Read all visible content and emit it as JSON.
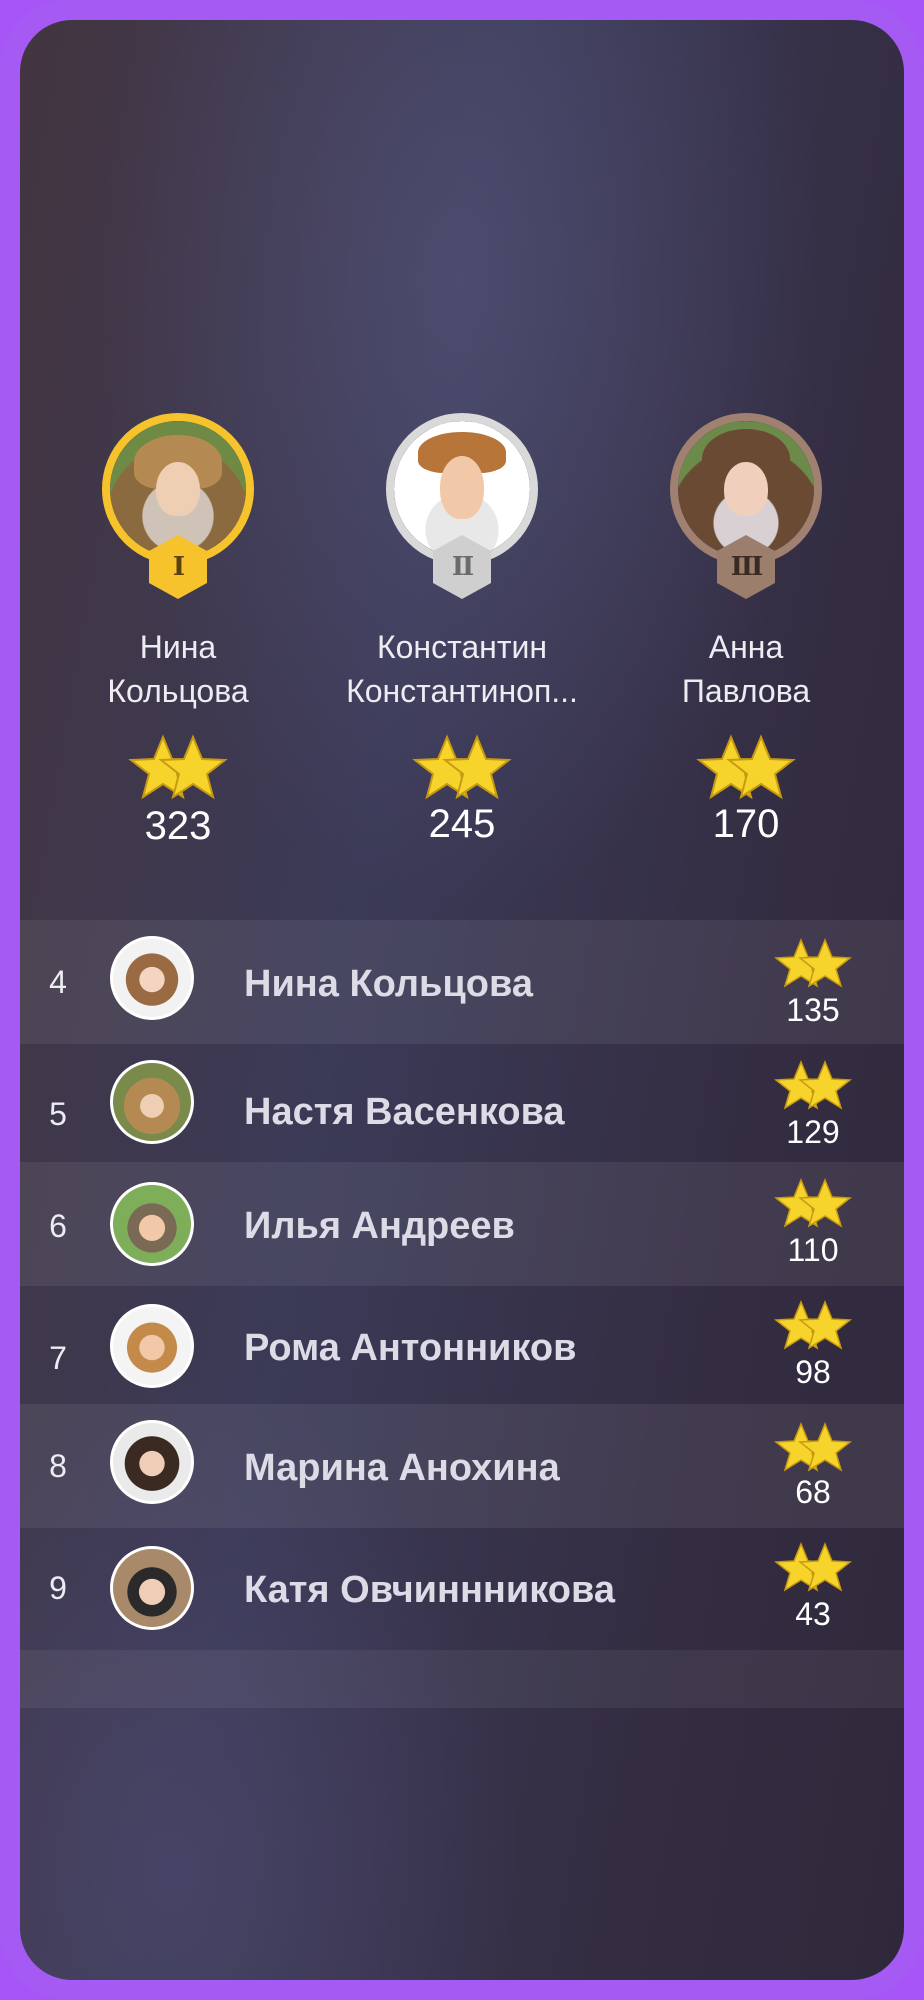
{
  "colors": {
    "frame": "#a855f7",
    "gold": "#f6c32c",
    "silver": "#d9d9d9",
    "bronze": "#a08070",
    "star": "#f6d42c"
  },
  "podium": [
    {
      "place_badge": "I",
      "badge_style": "gold",
      "name": "Нина\nКольцова",
      "score": "323"
    },
    {
      "place_badge": "II",
      "badge_style": "silver",
      "name": "Константин\nКонстантиноп...",
      "score": "245"
    },
    {
      "place_badge": "III",
      "badge_style": "bronze",
      "name": "Анна\nПавлова",
      "score": "170"
    }
  ],
  "leaderboard": [
    {
      "rank": "4",
      "name": "Нина Кольцова",
      "score": "135"
    },
    {
      "rank": "5",
      "name": "Настя Васенкова",
      "score": "129"
    },
    {
      "rank": "6",
      "name": "Илья Андреев",
      "score": "110"
    },
    {
      "rank": "7",
      "name": "Рома Антонников",
      "score": "98"
    },
    {
      "rank": "8",
      "name": "Марина Анохина",
      "score": "68"
    },
    {
      "rank": "9",
      "name": "Катя Овчиннникова",
      "score": "43"
    }
  ],
  "icons": {
    "star": "star-pair-icon",
    "rank_badge": "hexagon-rank-badge-icon"
  }
}
